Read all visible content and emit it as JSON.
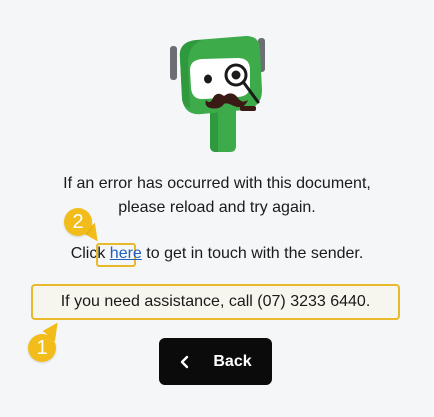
{
  "message": {
    "error_line1": "If an error has occurred with this document,",
    "error_line2": "please reload and try again.",
    "contact_prefix": "Click ",
    "contact_link": "here",
    "contact_suffix": " to get in touch with the sender."
  },
  "assistance": {
    "text": "If you need assistance, call (07) 3233 6440."
  },
  "back_button": {
    "label": "Back",
    "icon": "chevron-left-icon"
  },
  "mascot": {
    "icon": "robot-detective-mascot"
  },
  "annotations": {
    "badge_1": "1",
    "badge_2": "2"
  },
  "colors": {
    "background": "#f5f6f7",
    "highlight": "#e8b92a",
    "badge": "#f2bd1a",
    "link": "#1f5fbf",
    "button": "#0b0b0b",
    "mascot_green": "#3dab4a"
  }
}
